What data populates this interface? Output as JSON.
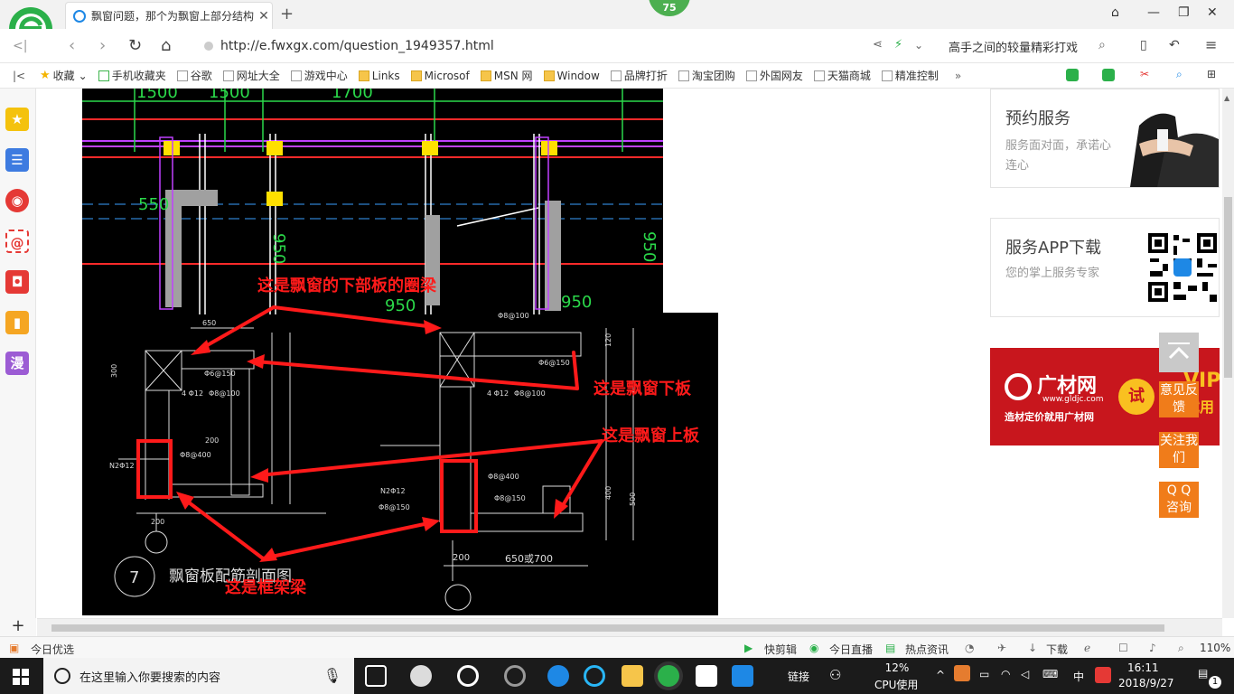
{
  "browser": {
    "tab_title": "飘窗问题，那个为飘窗上部分结构",
    "badge_count": "75",
    "url": "http://e.fwxgx.com/question_1949357.html",
    "search_hint": "高手之间的较量精彩打戏"
  },
  "bookmarks": [
    {
      "label": "收藏",
      "icon": "star-icon"
    },
    {
      "label": "手机收藏夹",
      "icon": "phone-icon"
    },
    {
      "label": "谷歌",
      "icon": "page-icon"
    },
    {
      "label": "网址大全",
      "icon": "page-icon"
    },
    {
      "label": "游戏中心",
      "icon": "page-icon"
    },
    {
      "label": "Links",
      "icon": "folder-icon"
    },
    {
      "label": "Microsof",
      "icon": "folder-icon"
    },
    {
      "label": "MSN 网",
      "icon": "folder-icon"
    },
    {
      "label": "Window",
      "icon": "folder-icon"
    },
    {
      "label": "品牌打折",
      "icon": "page-icon"
    },
    {
      "label": "淘宝团购",
      "icon": "page-icon"
    },
    {
      "label": "外国网友",
      "icon": "page-icon"
    },
    {
      "label": "天猫商城",
      "icon": "page-icon"
    },
    {
      "label": "精准控制",
      "icon": "page-icon"
    }
  ],
  "sidebar": {
    "manga_label": "漫"
  },
  "cad": {
    "dims_top": [
      "1500",
      "1500",
      "1700"
    ],
    "dim_550": "550",
    "dim_950a": "950",
    "dim_950b": "950",
    "dim_950c": "950",
    "dim_950d": "950",
    "annotations": {
      "lower_ring_beam": "这是飘窗的下部板的圈梁",
      "lower_slab": "这是飘窗下板",
      "upper_slab": "这是飘窗上板",
      "frame_beam": "这是框架梁"
    },
    "section_title": "飘窗板配筋剖面图",
    "section_number": "7",
    "labels": {
      "a": "650",
      "b": "Φ8@100",
      "c": "Φ6@150",
      "d": "4 Φ12",
      "e": "Φ8@100",
      "f": "Φ8@400",
      "g": "N2Φ12",
      "h": "Φ8@150",
      "i": "200",
      "j": "650或700",
      "k": "300",
      "l": "200",
      "m": "120",
      "n": "400",
      "o": "500"
    }
  },
  "right": {
    "card1_title": "预约服务",
    "card1_desc": "服务面对面，承诺心连心",
    "card2_title": "服务APP下载",
    "card2_desc": "您的掌上服务专家",
    "ad_brand": "广材网",
    "ad_url": "www.gldjc.com",
    "ad_slogan": "造材定价就用广材网",
    "ad_try": "试",
    "ad_vip": "VIP",
    "ad_use": "试用",
    "float_feedback": "意见反馈",
    "float_follow": "关注我们",
    "float_qq": "Q Q 咨询"
  },
  "statusbar": {
    "today": "今日优选",
    "clip": "快剪辑",
    "live": "今日直播",
    "news": "热点资讯",
    "download": "下载",
    "zoom": "110%"
  },
  "taskbar": {
    "search_placeholder": "在这里输入你要搜索的内容",
    "link": "链接",
    "cpu_pct": "12%",
    "cpu_label": "CPU使用",
    "ime": "中",
    "time": "16:11",
    "date": "2018/9/27",
    "notify_count": "1"
  },
  "colors": {
    "accent_green": "#4caf50",
    "ad_red": "#c8161d",
    "float_orange": "#f07c1a",
    "annotation_red": "#ff1a1a"
  }
}
